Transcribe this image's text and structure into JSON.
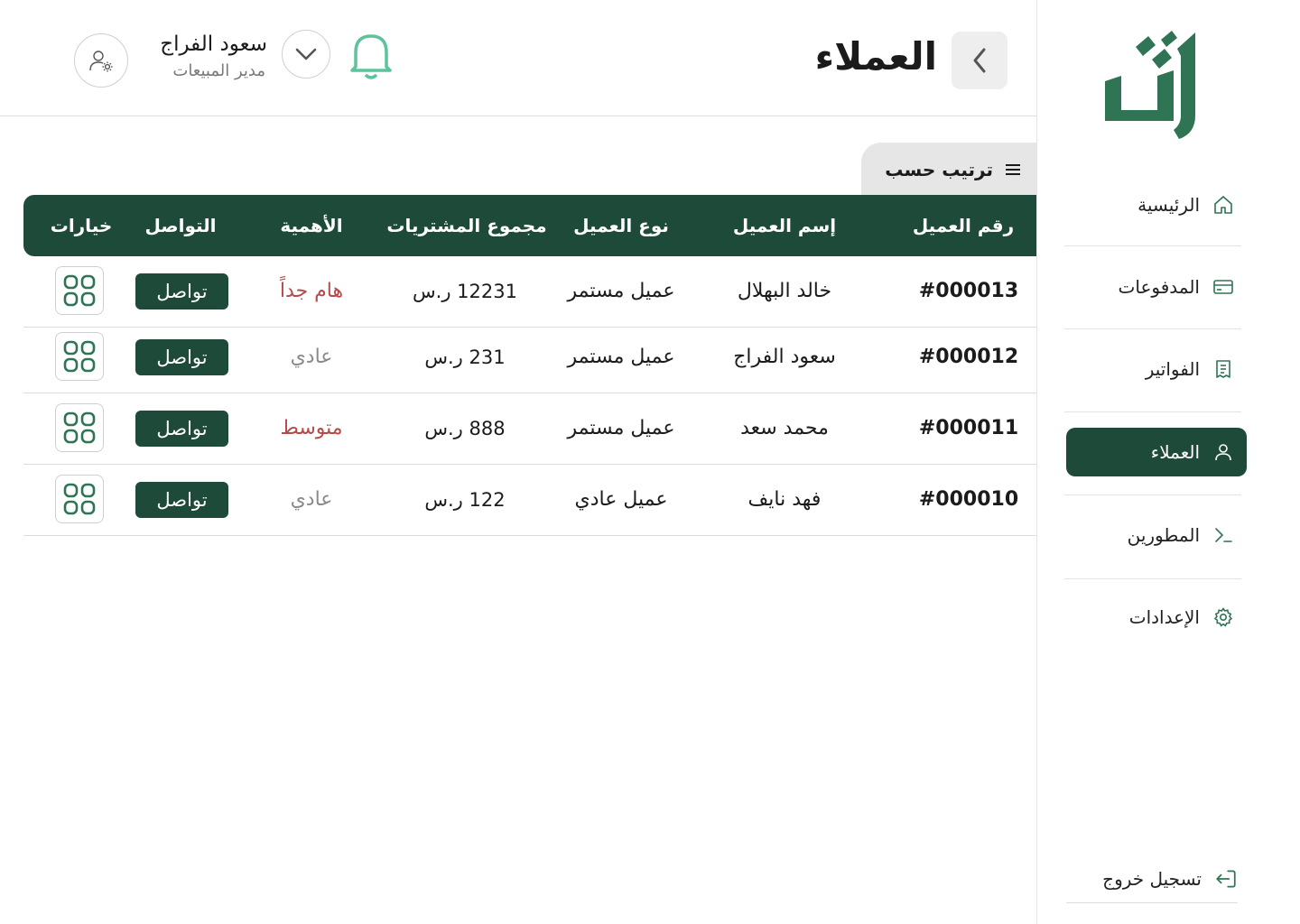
{
  "colors": {
    "primary": "#1e4a3a",
    "logo_green": "#2f7454",
    "bell_green": "#5cc49b",
    "priority_red": "#b64a4a",
    "priority_gray": "#8a8a8a"
  },
  "sidebar": {
    "logo_icon": "tl-logo",
    "items": [
      {
        "label": "الرئيسية",
        "icon": "home-icon",
        "active": false
      },
      {
        "label": "المدفوعات",
        "icon": "credit-card-icon",
        "active": false
      },
      {
        "label": "الفواتير",
        "icon": "invoice-icon",
        "active": false
      },
      {
        "label": "العملاء",
        "icon": "user-icon",
        "active": true
      },
      {
        "label": "المطورين",
        "icon": "terminal-icon",
        "active": false
      },
      {
        "label": "الإعدادات",
        "icon": "gear-icon",
        "active": false
      }
    ],
    "logout_label": "تسجيل خروج"
  },
  "header": {
    "title": "العملاء",
    "user_name": "سعود الفراج",
    "user_role": "مدير المبيعات"
  },
  "sort_label": "ترتيب حسب",
  "table": {
    "columns": [
      "رقم العميل",
      "إسم العميل",
      "نوع العميل",
      "مجموع المشتريات",
      "الأهمية",
      "التواصل",
      "خيارات"
    ],
    "contact_label": "تواصل",
    "rows": [
      {
        "id": "#000013",
        "name": "خالد البهلال",
        "type": "عميل مستمر",
        "total": "12231 ر.س",
        "priority": "هام جداً",
        "priority_color": "#b64a4a"
      },
      {
        "id": "#000012",
        "name": "سعود الفراج",
        "type": "عميل مستمر",
        "total": "231 ر.س",
        "priority": "عادي",
        "priority_color": "#8a8a8a"
      },
      {
        "id": "#000011",
        "name": "محمد سعد",
        "type": "عميل مستمر",
        "total": "888 ر.س",
        "priority": "متوسط",
        "priority_color": "#b64a4a"
      },
      {
        "id": "#000010",
        "name": "فهد نايف",
        "type": "عميل عادي",
        "total": "122 ر.س",
        "priority": "عادي",
        "priority_color": "#8a8a8a"
      }
    ]
  }
}
